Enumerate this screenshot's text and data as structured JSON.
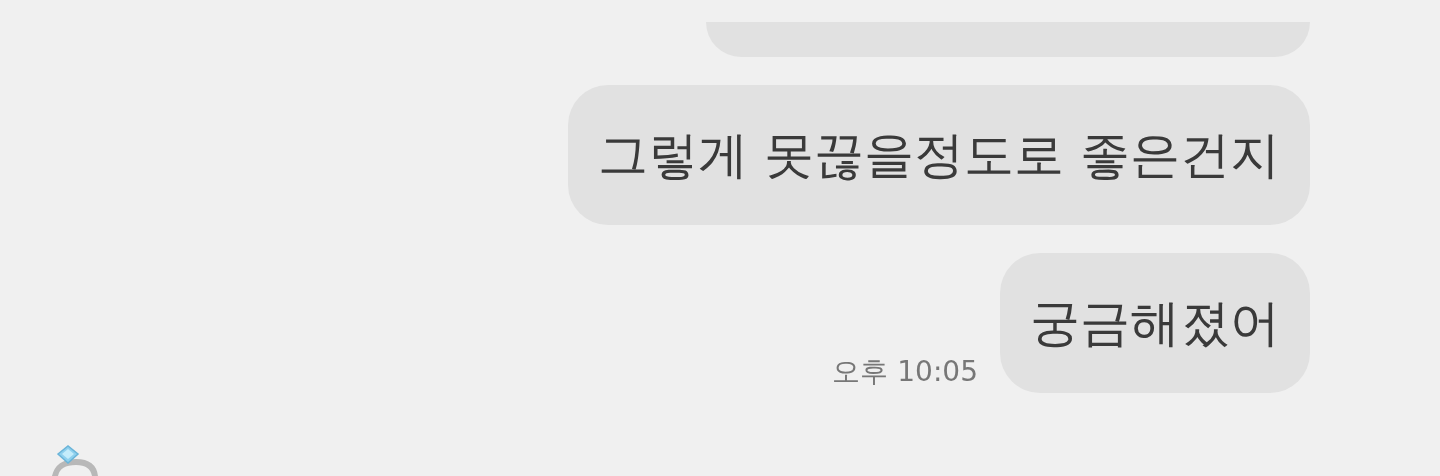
{
  "messages": [
    {
      "kind": "cut"
    },
    {
      "kind": "sent",
      "text": "그렇게 못끊을정도로 좋은건지"
    },
    {
      "kind": "sent",
      "text": "궁금해졌어",
      "time": "오후 10:05"
    }
  ],
  "received": {
    "kind": "ring"
  }
}
